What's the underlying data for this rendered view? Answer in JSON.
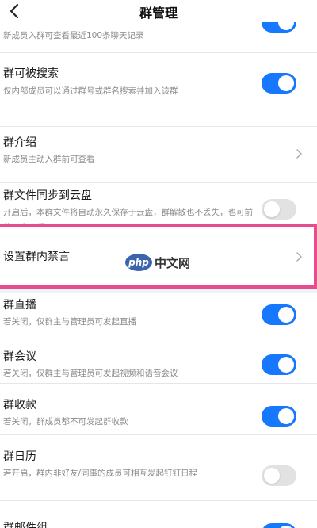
{
  "header": {
    "title": "群管理",
    "back_icon": "chevron-left-icon"
  },
  "items": {
    "history": {
      "desc": "新成员入群可查看最近100条聊天记录",
      "toggle_on": true
    },
    "searchable": {
      "title": "群可被搜索",
      "desc": "仅内部成员可以通过群号或群名搜索并加入该群",
      "toggle_on": true
    },
    "intro": {
      "title": "群介绍",
      "desc": "新成员主动入群前可查看"
    },
    "cloud_sync": {
      "title": "群文件同步到云盘",
      "desc": "开启后，本群文件将自动永久保存于云盘，群解散也不丢失，也可前往云盘查看",
      "toggle_on": false
    },
    "mute": {
      "title": "设置群内禁言"
    },
    "live": {
      "title": "群直播",
      "desc": "若关闭，仅群主与管理员可发起直播",
      "toggle_on": true
    },
    "meeting": {
      "title": "群会议",
      "desc": "若关闭，仅群主与管理员可发起视频和语音会议",
      "toggle_on": true
    },
    "payment": {
      "title": "群收款",
      "desc": "若关闭，群成员都不可发起群收款",
      "toggle_on": true
    },
    "calendar": {
      "title": "群日历",
      "desc": "若开启，群内非好友/同事的成员可相互发起钉钉日程",
      "toggle_on": false
    },
    "mail_group": {
      "title": "群邮件组",
      "toggle_on": true
    }
  },
  "watermark": {
    "logo_text": "php",
    "text": "中文网"
  },
  "colors": {
    "toggle_on": "#1677ff",
    "toggle_off": "#e2e2e2",
    "highlight": "#e64d8f"
  }
}
